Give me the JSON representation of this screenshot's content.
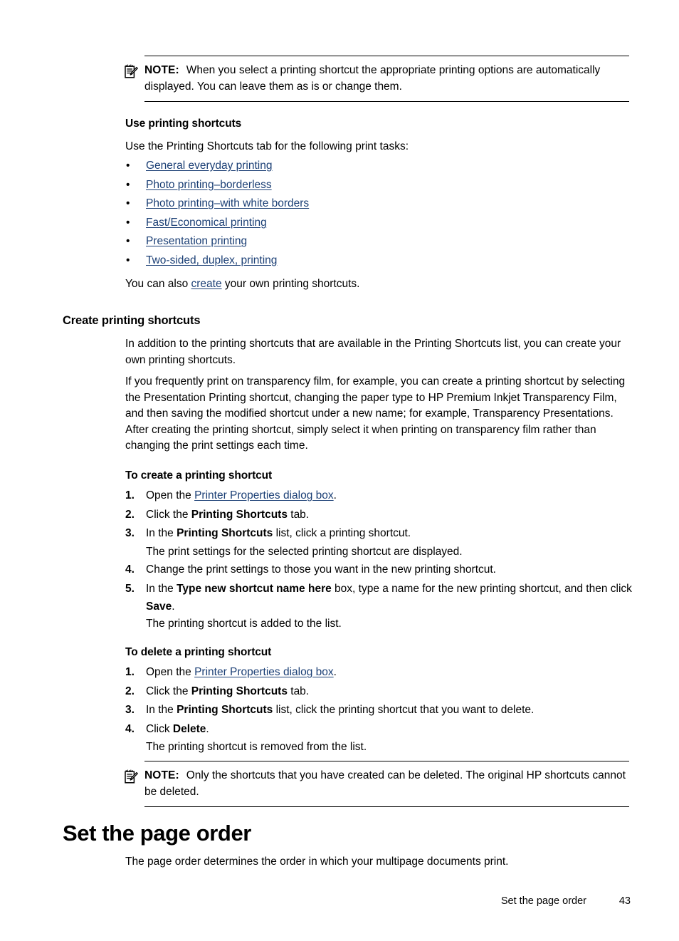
{
  "note_top": {
    "icon": "note-pad-pencil-icon",
    "label": "NOTE:",
    "text": "When you select a printing shortcut the appropriate printing options are automatically displayed. You can leave them as is or change them."
  },
  "use_shortcuts": {
    "heading": "Use printing shortcuts",
    "intro": "Use the Printing Shortcuts tab for the following print tasks:",
    "links": [
      "General everyday printing",
      "Photo printing–borderless",
      "Photo printing–with white borders",
      "Fast/Economical printing",
      "Presentation printing",
      "Two-sided, duplex, printing"
    ],
    "closing_pre": "You can also ",
    "closing_link": "create",
    "closing_post": " your own printing shortcuts."
  },
  "create_shortcuts": {
    "heading": "Create printing shortcuts",
    "para1": "In addition to the printing shortcuts that are available in the Printing Shortcuts list, you can create your own printing shortcuts.",
    "para2": "If you frequently print on transparency film, for example, you can create a printing shortcut by selecting the Presentation Printing shortcut, changing the paper type to HP Premium Inkjet Transparency Film, and then saving the modified shortcut under a new name; for example, Transparency Presentations. After creating the printing shortcut, simply select it when printing on transparency film rather than changing the print settings each time."
  },
  "to_create": {
    "heading": "To create a printing shortcut",
    "steps": [
      {
        "num": "1.",
        "pre": "Open the ",
        "link": "Printer Properties dialog box",
        "post": "."
      },
      {
        "num": "2.",
        "pre": "Click the ",
        "bold": "Printing Shortcuts",
        "post": " tab."
      },
      {
        "num": "3.",
        "pre": "In the ",
        "bold": "Printing Shortcuts",
        "post": " list, click a printing shortcut.",
        "sub": "The print settings for the selected printing shortcut are displayed."
      },
      {
        "num": "4.",
        "pre": "Change the print settings to those you want in the new printing shortcut."
      },
      {
        "num": "5.",
        "pre": "In the ",
        "bold": "Type new shortcut name here",
        "post": " box, type a name for the new printing shortcut, and then click ",
        "bold2": "Save",
        "post2": ".",
        "sub": "The printing shortcut is added to the list."
      }
    ]
  },
  "to_delete": {
    "heading": "To delete a printing shortcut",
    "steps": [
      {
        "num": "1.",
        "pre": "Open the ",
        "link": "Printer Properties dialog box",
        "post": "."
      },
      {
        "num": "2.",
        "pre": "Click the ",
        "bold": "Printing Shortcuts",
        "post": " tab."
      },
      {
        "num": "3.",
        "pre": "In the ",
        "bold": "Printing Shortcuts",
        "post": " list, click the printing shortcut that you want to delete."
      },
      {
        "num": "4.",
        "pre": "Click ",
        "bold": "Delete",
        "post": ".",
        "sub": "The printing shortcut is removed from the list."
      }
    ]
  },
  "note_bottom": {
    "icon": "note-pad-pencil-icon",
    "label": "NOTE:",
    "text": "Only the shortcuts that you have created can be deleted. The original HP shortcuts cannot be deleted."
  },
  "page_order": {
    "heading": "Set the page order",
    "para": "The page order determines the order in which your multipage documents print."
  },
  "footer": {
    "title": "Set the page order",
    "page": "43"
  },
  "colors": {
    "link": "#1b3f75",
    "text": "#000000",
    "rule": "#000000",
    "background": "#ffffff"
  }
}
